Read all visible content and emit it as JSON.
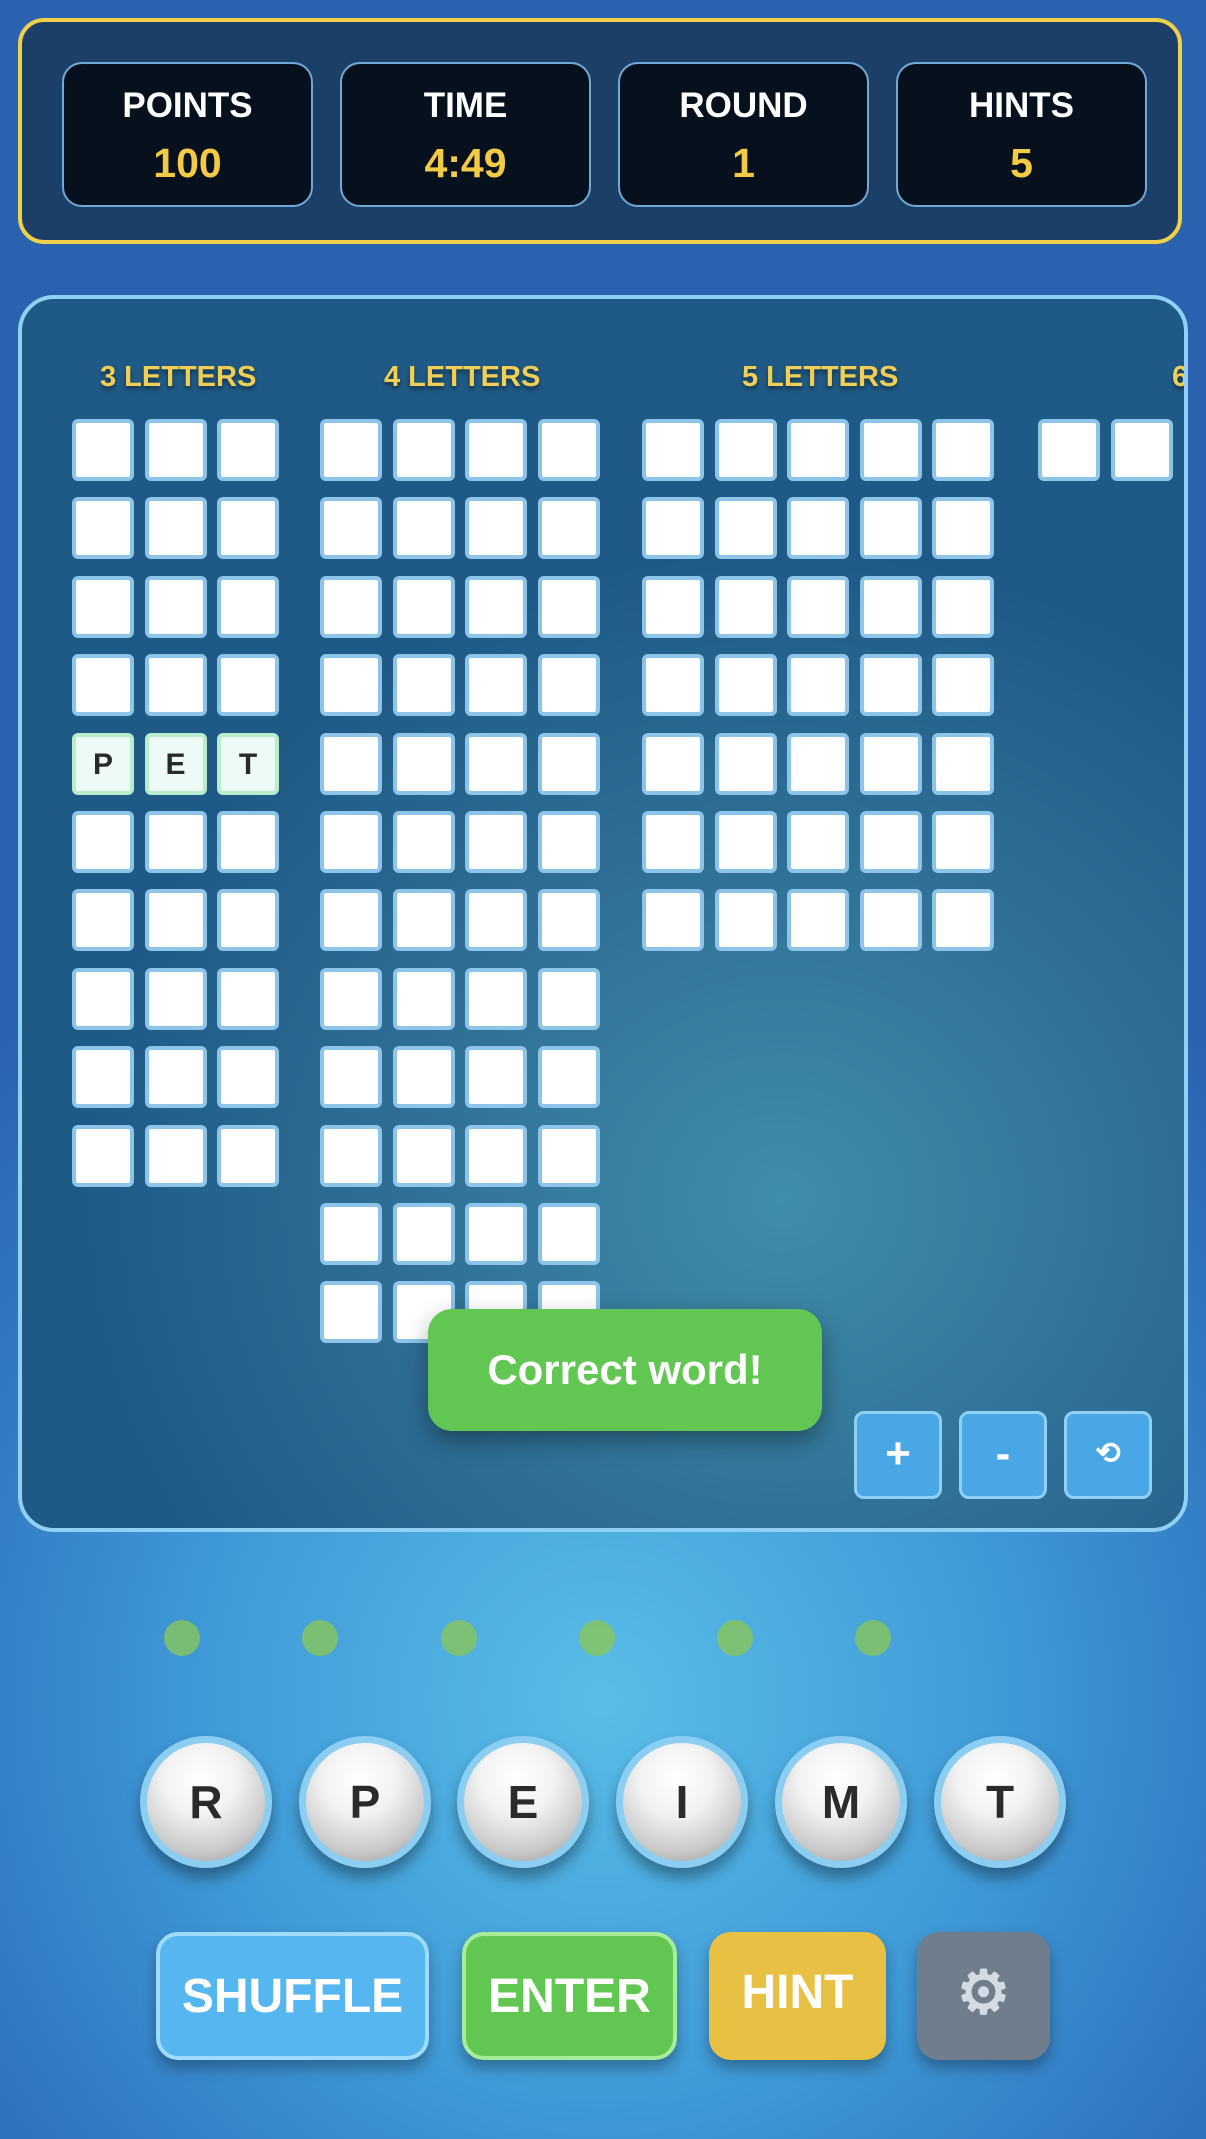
{
  "stats": [
    {
      "label": "POINTS",
      "value": "100"
    },
    {
      "label": "TIME",
      "value": "4:49"
    },
    {
      "label": "ROUND",
      "value": "1"
    },
    {
      "label": "HINTS",
      "value": "5"
    }
  ],
  "board": {
    "columns": [
      {
        "title": "3 LETTERS",
        "length": 3,
        "rows": 10
      },
      {
        "title": "4 LETTERS",
        "length": 4,
        "rows": 12
      },
      {
        "title": "5 LETTERS",
        "length": 5,
        "rows": 7
      },
      {
        "title": "6",
        "length": 2,
        "rows": 1
      }
    ],
    "found_words": [
      {
        "column": 0,
        "row": 4,
        "letters": [
          "P",
          "E",
          "T"
        ]
      }
    ],
    "controls": {
      "zoom_in": "+",
      "zoom_out": "-",
      "reset": "⟲"
    }
  },
  "toast": "Correct word!",
  "progress_dots": 6,
  "letters": [
    "R",
    "P",
    "E",
    "I",
    "M",
    "T"
  ],
  "actions": {
    "shuffle": "SHUFFLE",
    "enter": "ENTER",
    "hint": "HINT",
    "settings_icon": "⚙"
  },
  "colors": {
    "accent": "#f3ca45",
    "shuffle": "#56b6f0",
    "enter": "#62c653",
    "hint": "#e8c043",
    "settings": "#6f7d8c",
    "toast": "#62c653"
  }
}
